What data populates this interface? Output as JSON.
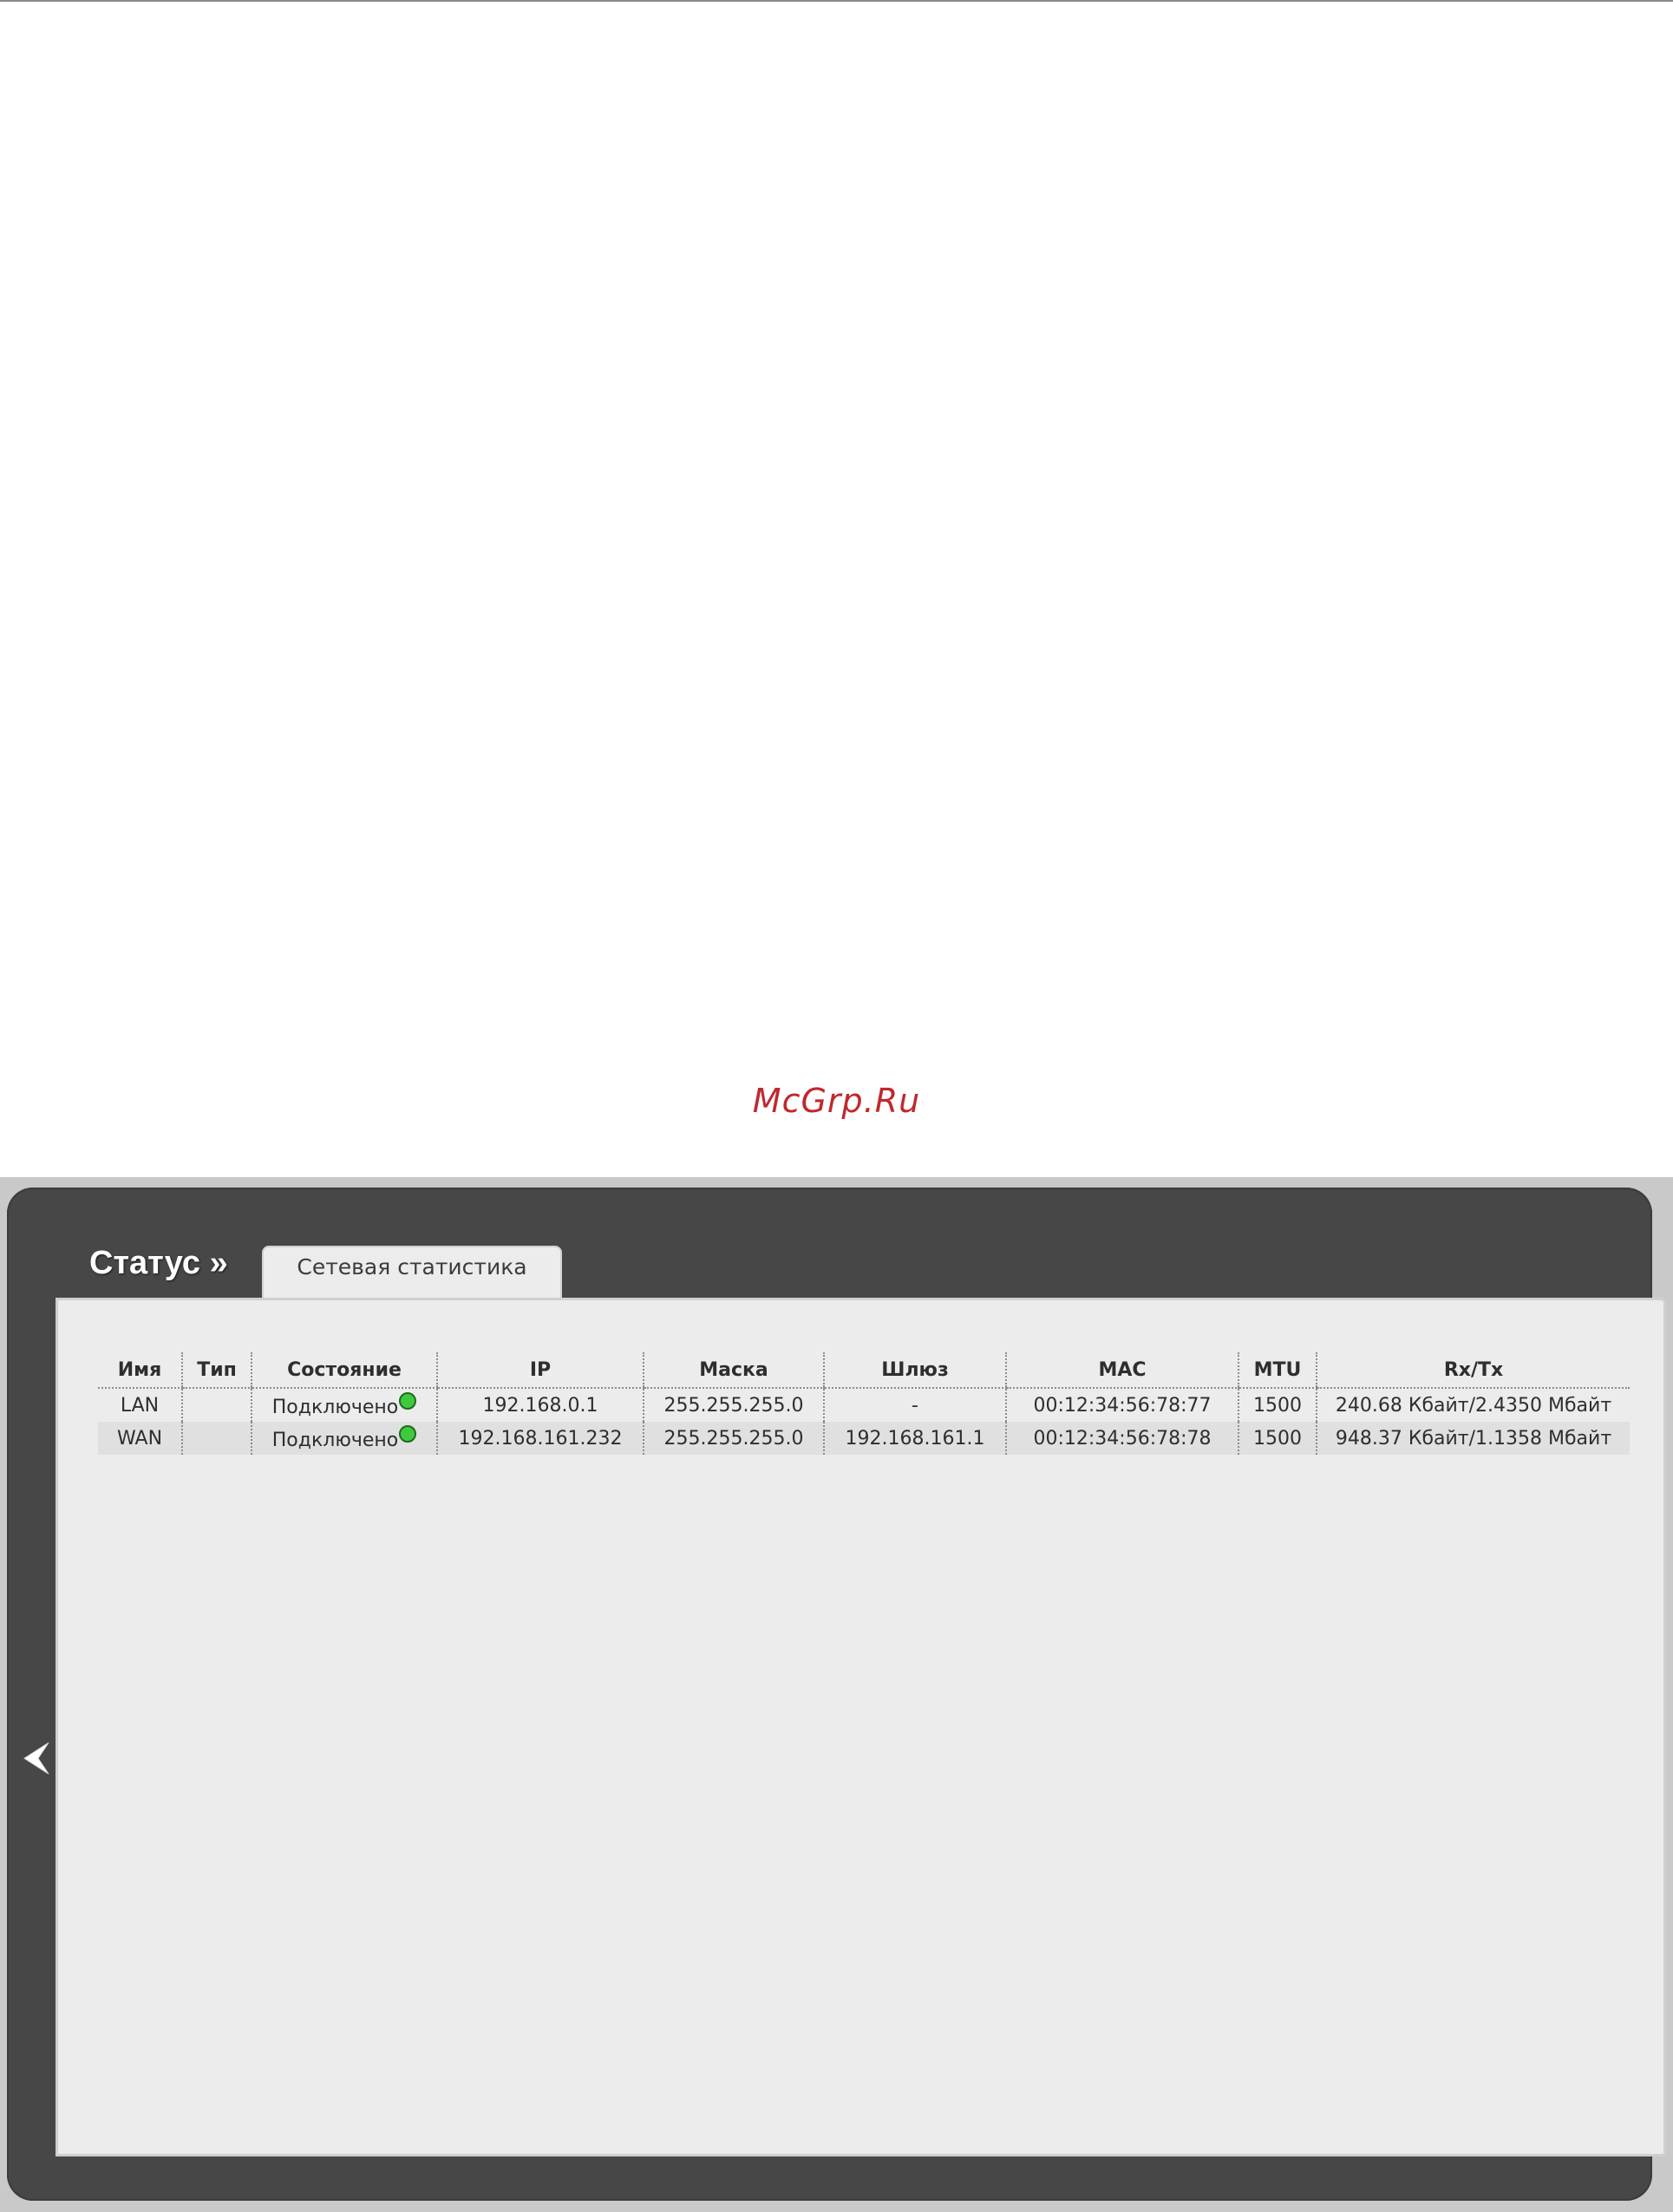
{
  "watermark": "McGrp.Ru",
  "header": {
    "section_title": "Статус »",
    "active_tab": "Сетевая статистика"
  },
  "table": {
    "columns": [
      "Имя",
      "Тип",
      "Состояние",
      "IP",
      "Маска",
      "Шлюз",
      "MAC",
      "MTU",
      "Rx/Tx"
    ],
    "rows": [
      {
        "name": "LAN",
        "type": "",
        "state": "Подключено",
        "ip": "192.168.0.1",
        "mask": "255.255.255.0",
        "gateway": "-",
        "mac": "00:12:34:56:78:77",
        "mtu": "1500",
        "rxtx": "240.68 Кбайт/2.4350 Мбайт"
      },
      {
        "name": "WAN",
        "type": "",
        "state": "Подключено",
        "ip": "192.168.161.232",
        "mask": "255.255.255.0",
        "gateway": "192.168.161.1",
        "mac": "00:12:34:56:78:78",
        "mtu": "1500",
        "rxtx": "948.37 Кбайт/1.1358 Мбайт"
      }
    ]
  },
  "icons": {
    "status_connected": "green-dot-icon",
    "back": "chevron-left-icon"
  },
  "colors": {
    "frame": "#474747",
    "panel": "#ececec",
    "watermark": "#c0282e",
    "status_connected": "#3fc93f"
  }
}
